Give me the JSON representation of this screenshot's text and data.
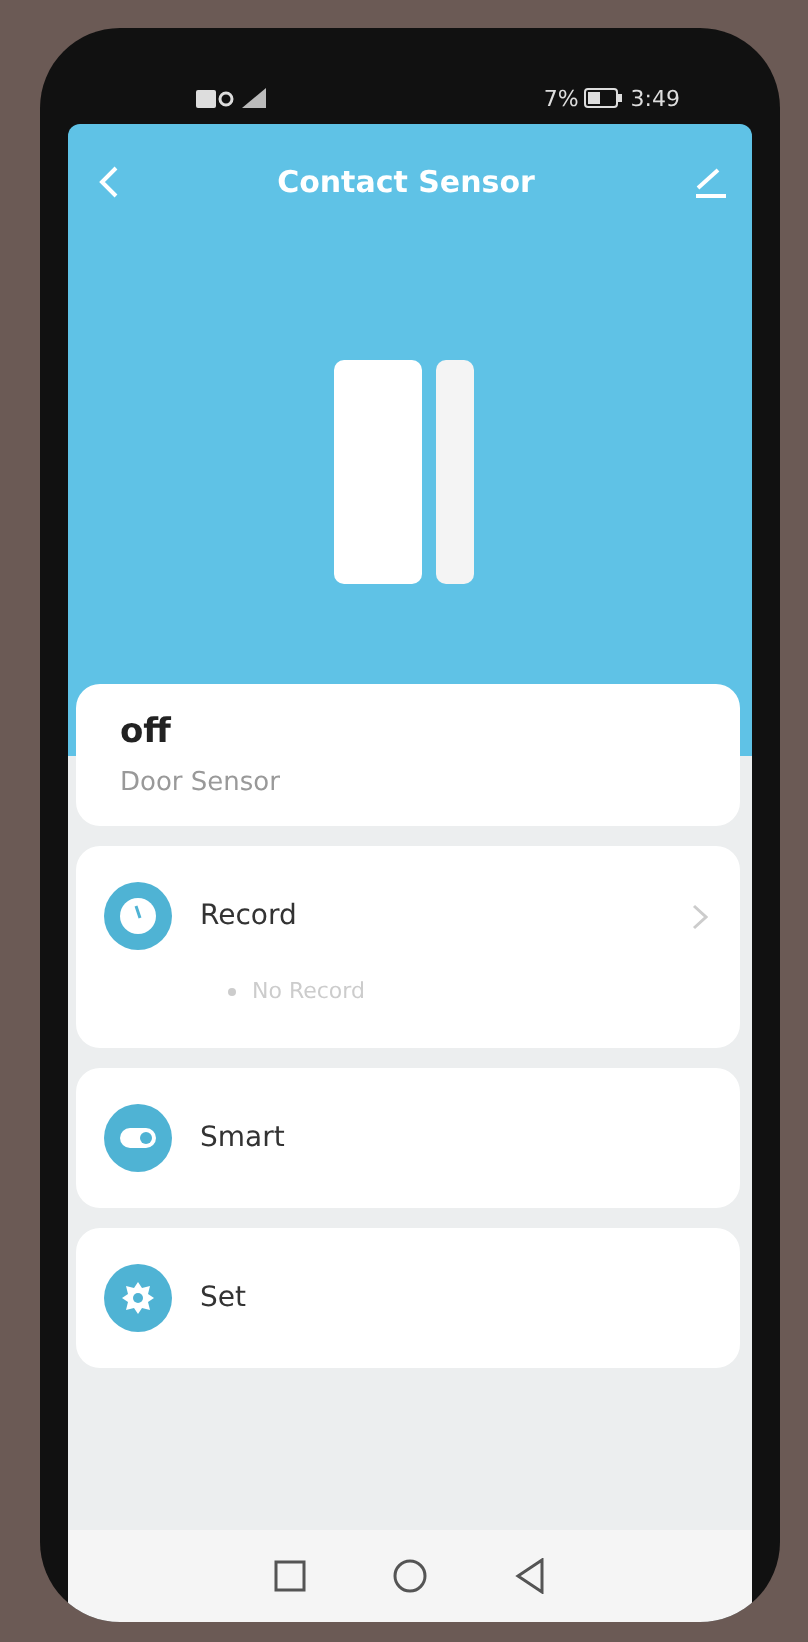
{
  "status_bar": {
    "battery": "7%",
    "time": "3:49"
  },
  "header": {
    "title": "Contact Sensor"
  },
  "status_card": {
    "state": "off",
    "device": "Door Sensor"
  },
  "rows": [
    {
      "label": "Record",
      "kind": "link",
      "detail": "No Record"
    },
    {
      "label": "Smart",
      "kind": "plain"
    },
    {
      "label": "Set",
      "kind": "plain"
    }
  ]
}
